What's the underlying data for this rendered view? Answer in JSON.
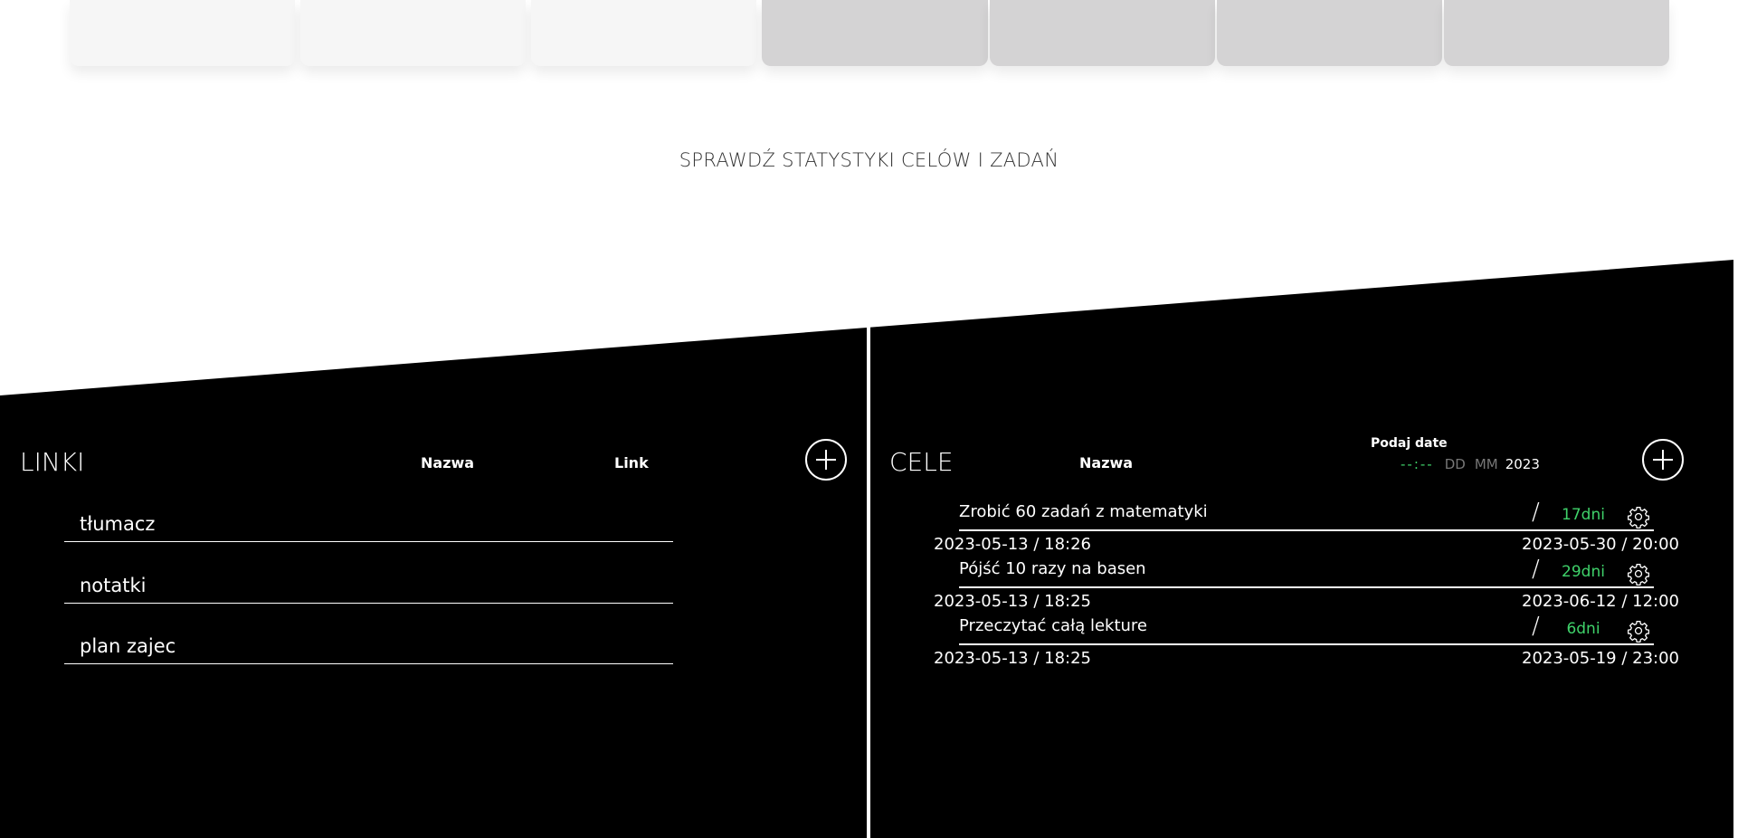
{
  "header": {
    "stats_link": "SPRAWDŹ STATYSTYKI CELÓW I ZADAŃ"
  },
  "colors": {
    "panel_bg": "#000000",
    "accent_green": "#3fd26a",
    "card_light": "#f6f6f6",
    "card_dark": "#d4d3d4"
  },
  "links_panel": {
    "title": "LINKI",
    "col_name": "Nazwa",
    "col_link": "Link",
    "add_icon": "plus-circle-icon",
    "items": [
      {
        "label": "tłumacz"
      },
      {
        "label": "notatki"
      },
      {
        "label": "plan zajec"
      }
    ]
  },
  "goals_panel": {
    "title": "CELE",
    "col_name": "Nazwa",
    "date_label": "Podaj date",
    "date_input": {
      "time_placeholder": "--:--",
      "day_placeholder": "DD",
      "month_placeholder": "MM",
      "year": "2023"
    },
    "add_icon": "plus-circle-icon",
    "items": [
      {
        "name": "Zrobić 60 zadań z matematyki",
        "slash": "/",
        "days": "17dni",
        "start": "2023-05-13 / 18:26",
        "end": "2023-05-30 / 20:00"
      },
      {
        "name": "Pójść 10 razy na basen",
        "slash": "/",
        "days": "29dni",
        "start": "2023-05-13 / 18:25",
        "end": "2023-06-12 / 12:00"
      },
      {
        "name": "Przeczytać całą lekture",
        "slash": "/",
        "days": "6dni",
        "start": "2023-05-13 / 18:25",
        "end": "2023-05-19 / 23:00"
      }
    ]
  }
}
